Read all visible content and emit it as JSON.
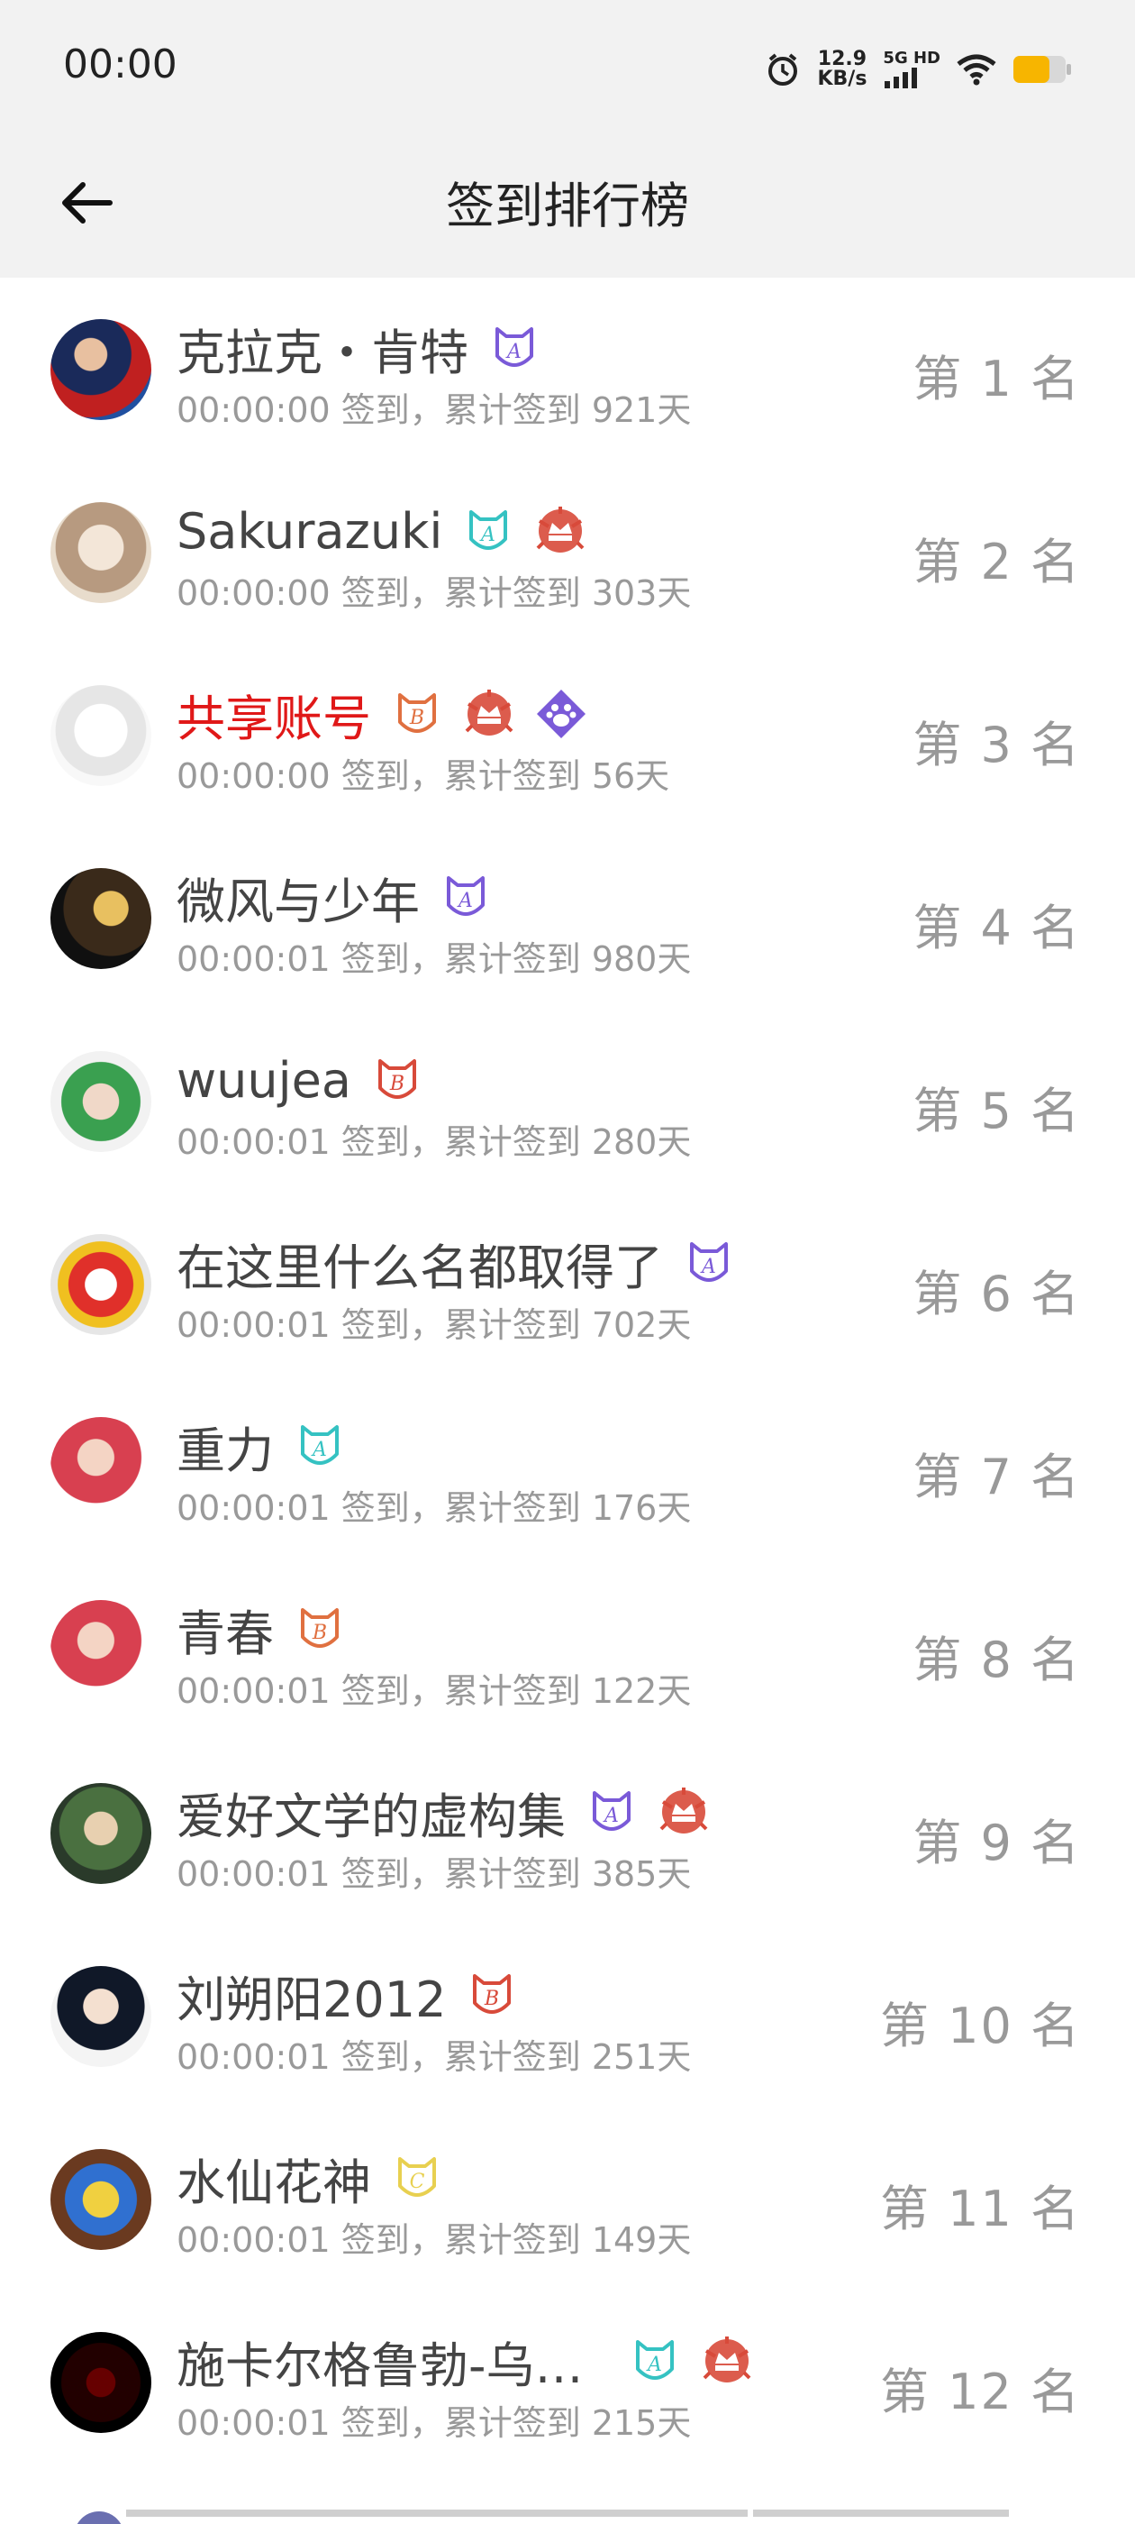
{
  "status": {
    "time": "00:00",
    "speed_value": "12.9",
    "speed_unit": "KB/s",
    "network": "5G HD"
  },
  "header": {
    "title": "签到排行榜"
  },
  "colors": {
    "accent_red": "#e01818",
    "text_gray": "#999999",
    "badge_purple": "#7a5ad8",
    "badge_teal": "#35c2c2",
    "badge_orange": "#e07040",
    "badge_red": "#d84a3a",
    "badge_yellow": "#e8d050"
  },
  "entries": [
    {
      "name": "克拉克・肯特",
      "sign": "00:00:00 签到，累计签到 921天",
      "rank": "第 1 名",
      "badges": [
        "purple-A-badge-icon"
      ]
    },
    {
      "name": "Sakurazuki",
      "sign": "00:00:00 签到，累计签到 303天",
      "rank": "第 2 名",
      "badges": [
        "teal-A-badge-icon",
        "red-crown-badge-icon"
      ]
    },
    {
      "name": "共享账号",
      "sign": "00:00:00 签到，累计签到 56天",
      "rank": "第 3 名",
      "badges": [
        "orange-B-badge-icon",
        "red-crown-badge-icon",
        "purple-paw-badge-icon"
      ]
    },
    {
      "name": "微风与少年",
      "sign": "00:00:01 签到，累计签到 980天",
      "rank": "第 4 名",
      "badges": [
        "purple-A-badge-icon"
      ]
    },
    {
      "name": "wuujea",
      "sign": "00:00:01 签到，累计签到 280天",
      "rank": "第 5 名",
      "badges": [
        "red-B-badge-icon"
      ]
    },
    {
      "name": "在这里什么名都取得了",
      "sign": "00:00:01 签到，累计签到 702天",
      "rank": "第 6 名",
      "badges": [
        "purple-A-badge-icon"
      ]
    },
    {
      "name": "重力",
      "sign": "00:00:01 签到，累计签到 176天",
      "rank": "第 7 名",
      "badges": [
        "teal-A-badge-icon"
      ]
    },
    {
      "name": "青春",
      "sign": "00:00:01 签到，累计签到 122天",
      "rank": "第 8 名",
      "badges": [
        "orange-B-badge-icon"
      ]
    },
    {
      "name": "爱好文学的虚构集",
      "sign": "00:00:01 签到，累计签到 385天",
      "rank": "第 9 名",
      "badges": [
        "purple-A-badge-icon",
        "red-crown-badge-icon"
      ]
    },
    {
      "name": "刘朔阳2012",
      "sign": "00:00:01 签到，累计签到 251天",
      "rank": "第 10 名",
      "badges": [
        "red-B-badge-icon"
      ]
    },
    {
      "name": "水仙花神",
      "sign": "00:00:01 签到，累计签到 149天",
      "rank": "第 11 名",
      "badges": [
        "yellow-C-badge-icon"
      ]
    },
    {
      "name": "施卡尔格鲁勃-乌…",
      "sign": "00:00:01 签到，累计签到 215天",
      "rank": "第 12 名",
      "badges": [
        "teal-A-badge-icon",
        "red-crown-badge-icon"
      ]
    }
  ]
}
